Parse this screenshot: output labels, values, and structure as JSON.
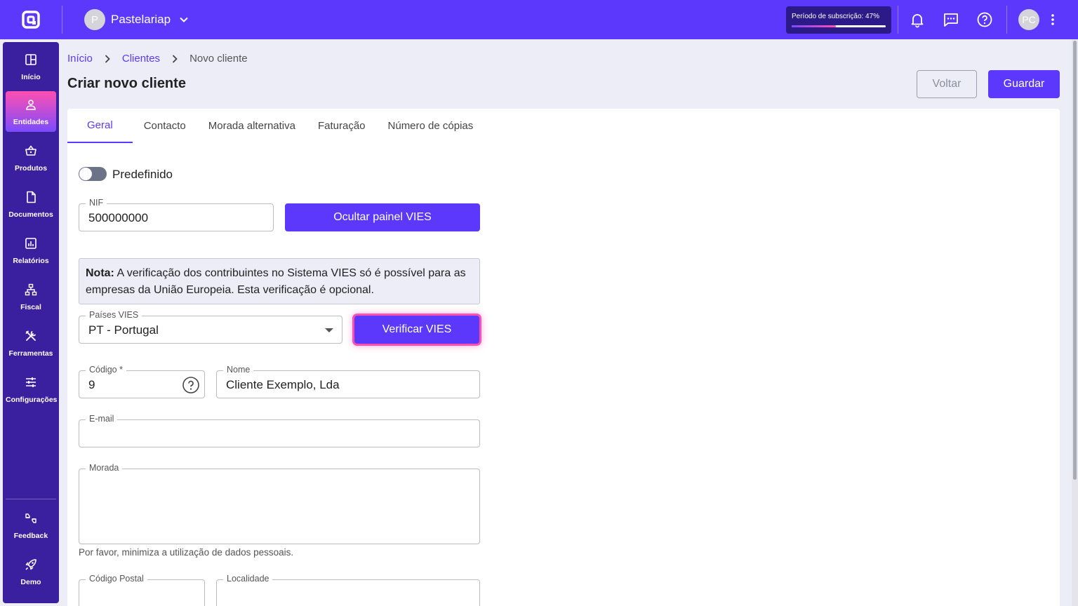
{
  "topbar": {
    "company_initial": "P",
    "company_name": "Pastelariap",
    "subscription_label": "Período de subscrição: 47%",
    "subscription_progress": 0.47,
    "user_initials": "PC"
  },
  "sidebar": {
    "items": [
      {
        "label": "Início",
        "icon": "dashboard-icon"
      },
      {
        "label": "Entidades",
        "icon": "person-icon",
        "active": true
      },
      {
        "label": "Produtos",
        "icon": "basket-icon"
      },
      {
        "label": "Documentos",
        "icon": "document-icon"
      },
      {
        "label": "Relatórios",
        "icon": "chart-icon"
      },
      {
        "label": "Fiscal",
        "icon": "network-icon"
      },
      {
        "label": "Ferramentas",
        "icon": "tools-icon"
      },
      {
        "label": "Configurações",
        "icon": "sliders-icon"
      }
    ],
    "bottom": [
      {
        "label": "Feedback",
        "icon": "feedback-icon"
      },
      {
        "label": "Demo",
        "icon": "rocket-icon"
      }
    ]
  },
  "breadcrumb": {
    "home": "Início",
    "clients": "Clientes",
    "current": "Novo cliente"
  },
  "page": {
    "title": "Criar novo cliente",
    "back_label": "Voltar",
    "save_label": "Guardar"
  },
  "tabs": [
    "Geral",
    "Contacto",
    "Morada alternativa",
    "Faturação",
    "Número de cópias"
  ],
  "form": {
    "default_label": "Predefinido",
    "nif": {
      "label": "NIF",
      "value": "500000000"
    },
    "vies_panel_button": "Ocultar painel VIES",
    "note_bold": "Nota:",
    "note_text": " A verificação dos contribuintes no Sistema VIES só é possível para as empresas da União Europeia. Esta verificação é opcional.",
    "vies_country": {
      "label": "Países VIES",
      "value": "PT - Portugal"
    },
    "verify_button": "Verificar VIES",
    "code": {
      "label": "Código *",
      "value": "9"
    },
    "name": {
      "label": "Nome",
      "value": "Cliente Exemplo, Lda"
    },
    "email": {
      "label": "E-mail",
      "value": ""
    },
    "address": {
      "label": "Morada",
      "value": ""
    },
    "address_hint": "Por favor, minimiza a utilização de dados pessoais.",
    "postal_code": {
      "label": "Código Postal",
      "value": ""
    },
    "locality": {
      "label": "Localidade",
      "value": ""
    }
  },
  "colors": {
    "accent": "#5b38fb",
    "sidebar": "#3a1f9e",
    "focus": "#ff4fb0"
  }
}
